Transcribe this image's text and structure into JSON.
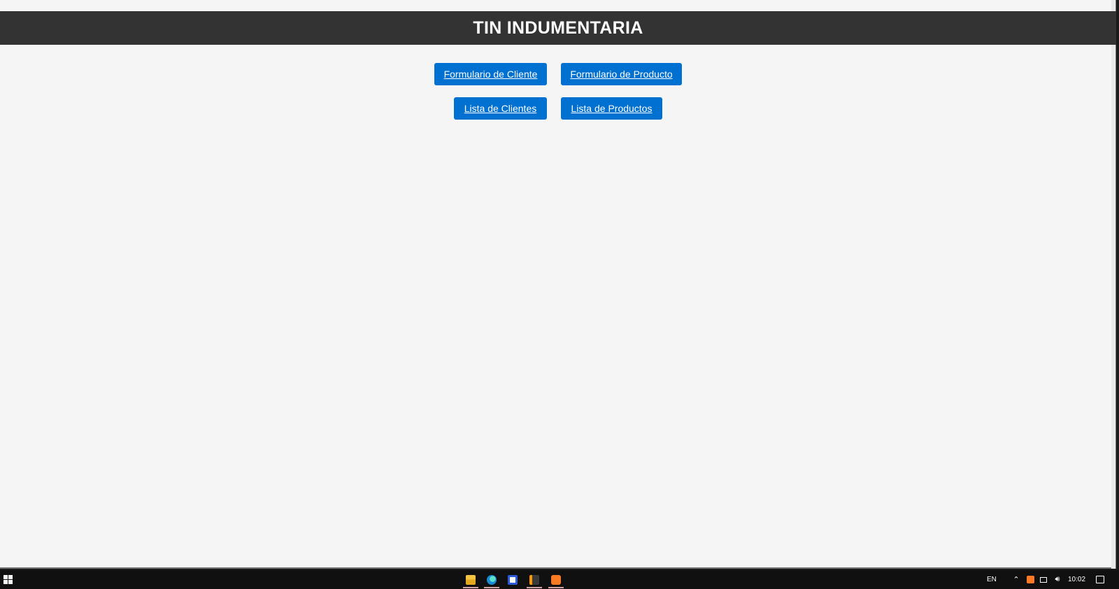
{
  "header": {
    "title": "TIN INDUMENTARIA",
    "background": "#333333",
    "text_color": "#ffffff"
  },
  "nav": {
    "button_color": "#0070d1",
    "buttons": [
      {
        "label": "Formulario de Cliente"
      },
      {
        "label": "Formulario de Producto"
      },
      {
        "label": "Lista de Clientes"
      },
      {
        "label": "Lista de Productos"
      }
    ]
  },
  "taskbar": {
    "apps": [
      {
        "icon": "file-explorer-icon"
      },
      {
        "icon": "edge-browser-icon"
      },
      {
        "icon": "store-icon"
      },
      {
        "icon": "sublime-text-icon"
      },
      {
        "icon": "xampp-icon"
      }
    ],
    "tray": {
      "language": "EN",
      "time": "10:02"
    }
  }
}
